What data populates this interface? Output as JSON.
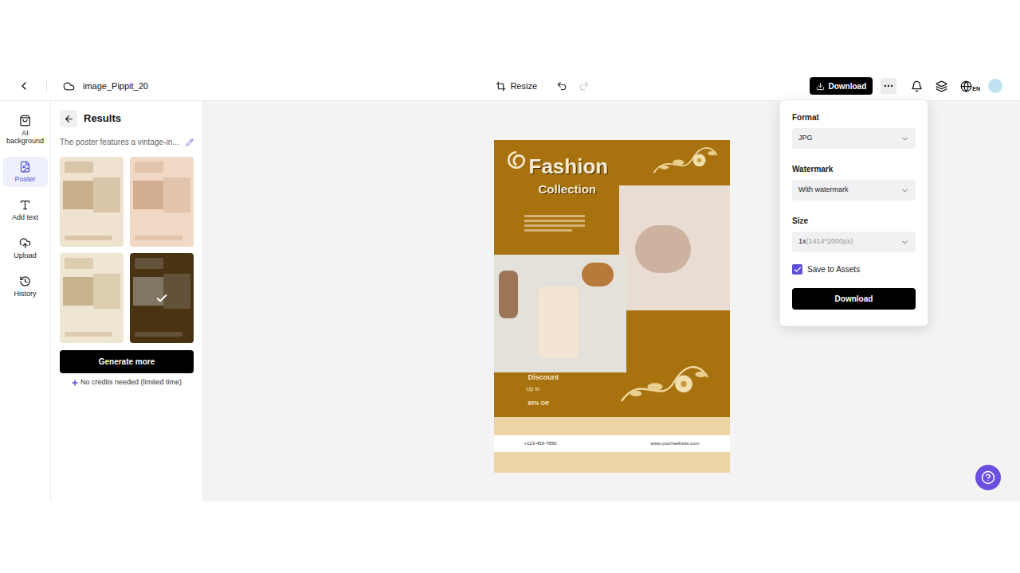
{
  "topbar": {
    "file_name": "image_Pippit_20",
    "resize": "Resize",
    "redo_disabled": true,
    "download": "Download",
    "language": "EN"
  },
  "sidebar": {
    "items": [
      {
        "label": "AI background",
        "selected": false
      },
      {
        "label": "Poster",
        "selected": true
      },
      {
        "label": "Add text",
        "selected": false
      },
      {
        "label": "Upload",
        "selected": false
      },
      {
        "label": "History",
        "selected": false
      }
    ]
  },
  "panel": {
    "title": "Results",
    "prompt": "The poster features a vintage-in...",
    "thumbnails": [
      {
        "selected": false
      },
      {
        "selected": false
      },
      {
        "selected": false
      },
      {
        "selected": true
      }
    ],
    "generate_button": "Generate more",
    "note": "No credits needed (limited time)"
  },
  "poster": {
    "title": "Fashion",
    "subtitle": "Collection",
    "discount": "Discount",
    "up_to": "Up to",
    "offer": "60% Off",
    "phone": "+123-456-7890",
    "website": "www.yourrwebsite.com"
  },
  "download_menu": {
    "fields": [
      {
        "label": "Format",
        "value": "JPG",
        "hint": ""
      },
      {
        "label": "Watermark",
        "value": "With watermark",
        "hint": ""
      },
      {
        "label": "Size",
        "value": "1x",
        "hint": "(1414*2000px)"
      }
    ],
    "save_to_assets": {
      "label": "Save to Assets",
      "checked": true
    },
    "button": "Download"
  }
}
